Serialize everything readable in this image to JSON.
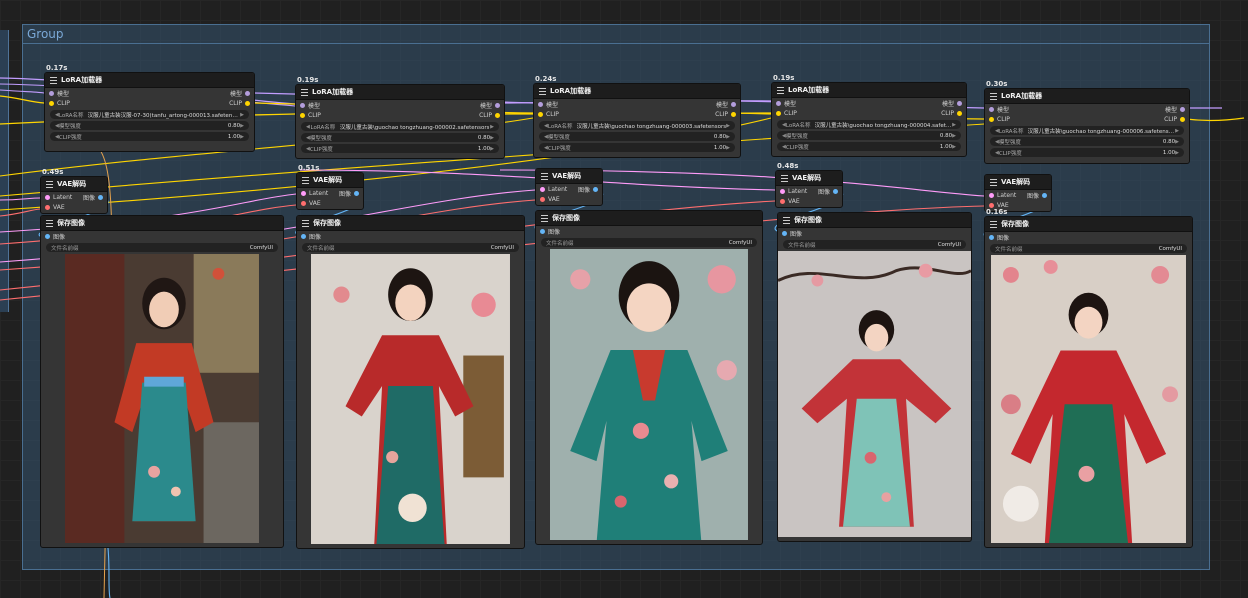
{
  "group": {
    "title": "Group"
  },
  "colors": {
    "group_bg": "#345470",
    "model": "#b39ddb",
    "clip": "#ffd500",
    "latent": "#ff9cf9",
    "vae": "#ff6e6e",
    "image": "#64b5f6",
    "node_title": "#1d1d1d",
    "node_body": "#353535"
  },
  "lora_nodes": [
    {
      "time": "0.17s",
      "title": "LoRA加载器",
      "in_model": "模型",
      "in_clip": "CLIP",
      "out_model": "模型",
      "out_clip": "CLIP",
      "lora_label": "LoRA名称",
      "lora_value": "汉服儿童古装汉服-07-30(tanfu_artong-000013.safetensors",
      "model_label": "模型强度",
      "model_value": "0.80",
      "clip_label": "CLIP强度",
      "clip_value": "1.00"
    },
    {
      "time": "0.19s",
      "title": "LoRA加载器",
      "in_model": "模型",
      "in_clip": "CLIP",
      "out_model": "模型",
      "out_clip": "CLIP",
      "lora_label": "LoRA名称",
      "lora_value": "汉服儿童古装\\guochao tongzhuang-000002.safetensors",
      "model_label": "模型强度",
      "model_value": "0.80",
      "clip_label": "CLIP强度",
      "clip_value": "1.00"
    },
    {
      "time": "0.24s",
      "title": "LoRA加载器",
      "in_model": "模型",
      "in_clip": "CLIP",
      "out_model": "模型",
      "out_clip": "CLIP",
      "lora_label": "LoRA名称",
      "lora_value": "汉服儿童古装\\guochao tongzhuang-000003.safetensors",
      "model_label": "模型强度",
      "model_value": "0.80",
      "clip_label": "CLIP强度",
      "clip_value": "1.00"
    },
    {
      "time": "0.19s",
      "title": "LoRA加载器",
      "in_model": "模型",
      "in_clip": "CLIP",
      "out_model": "模型",
      "out_clip": "CLIP",
      "lora_label": "LoRA名称",
      "lora_value": "汉服儿童古装\\guochao tongzhuang-000004.safetensors",
      "model_label": "模型强度",
      "model_value": "0.80",
      "clip_label": "CLIP强度",
      "clip_value": "1.00"
    },
    {
      "time": "0.30s",
      "title": "LoRA加载器",
      "in_model": "模型",
      "in_clip": "CLIP",
      "out_model": "模型",
      "out_clip": "CLIP",
      "lora_label": "LoRA名称",
      "lora_value": "汉服儿童古装\\guochao tongzhuang-000006.safetensors",
      "model_label": "模型强度",
      "model_value": "0.80",
      "clip_label": "CLIP强度",
      "clip_value": "1.00"
    }
  ],
  "vae_nodes": [
    {
      "time": "0.49s",
      "title": "VAE解码",
      "in_latent": "Latent",
      "in_vae": "VAE",
      "out_image": "图像"
    },
    {
      "time": "0.51s",
      "title": "VAE解码",
      "in_latent": "Latent",
      "in_vae": "VAE",
      "out_image": "图像"
    },
    {
      "time": "",
      "title": "VAE解码",
      "in_latent": "Latent",
      "in_vae": "VAE",
      "out_image": "图像"
    },
    {
      "time": "0.48s",
      "title": "VAE解码",
      "in_latent": "Latent",
      "in_vae": "VAE",
      "out_image": "图像"
    },
    {
      "time": "",
      "title": "VAE解码",
      "in_latent": "Latent",
      "in_vae": "VAE",
      "out_image": "图像"
    }
  ],
  "save_nodes": [
    {
      "time": "",
      "title": "保存图像",
      "in_image": "图像",
      "prefix_label": "文件名前缀",
      "prefix_value": "ComfyUI"
    },
    {
      "time": "",
      "title": "保存图像",
      "in_image": "图像",
      "prefix_label": "文件名前缀",
      "prefix_value": "ComfyUI"
    },
    {
      "time": "",
      "title": "保存图像",
      "in_image": "图像",
      "prefix_label": "文件名前缀",
      "prefix_value": "ComfyUI"
    },
    {
      "time": "",
      "title": "保存图像",
      "in_image": "图像",
      "prefix_label": "文件名前缀",
      "prefix_value": "ComfyUI"
    },
    {
      "time": "0.16s",
      "title": "保存图像",
      "in_image": "图像",
      "prefix_label": "文件名前缀",
      "prefix_value": "ComfyUI"
    }
  ]
}
